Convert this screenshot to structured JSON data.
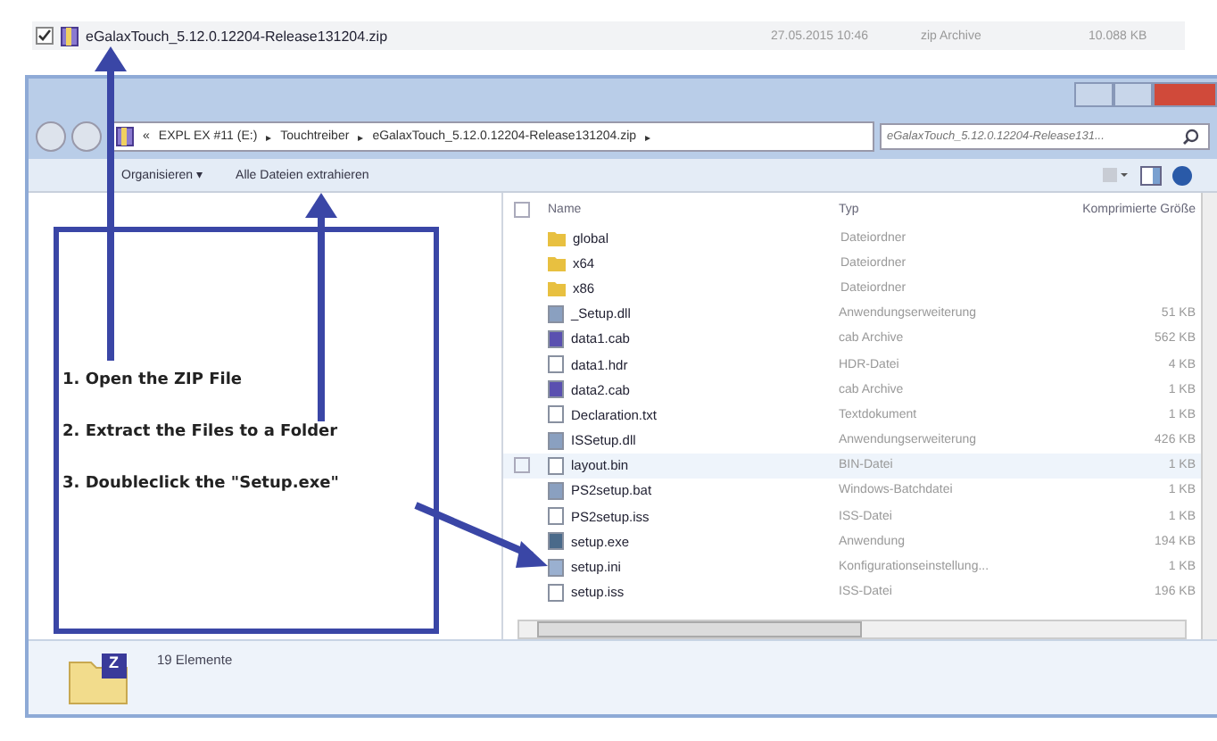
{
  "file_row": {
    "checked": true,
    "name": "eGalaxTouch_5.12.0.12204-Release131204.zip",
    "date": "27.05.2015 10:46",
    "type": "zip Archive",
    "size": "10.088 KB"
  },
  "address_bar": {
    "overflow": "«",
    "crumbs": [
      "EXPL EX #11 (E:)",
      "Touchtreiber",
      "eGalaxTouch_5.12.0.12204-Release131204.zip"
    ],
    "separator": "▸"
  },
  "search": {
    "placeholder": "eGalaxTouch_5.12.0.12204-Release131..."
  },
  "toolbar": {
    "organize": "Organisieren ▾",
    "extract": "Alle Dateien extrahieren"
  },
  "table": {
    "select_all_checked": false,
    "columns": [
      "Name",
      "Typ",
      "Komprimierte Größe"
    ],
    "rows": [
      {
        "kind": "folder",
        "name": "global",
        "type": "Dateiordner",
        "size": "",
        "highlighted": false
      },
      {
        "kind": "folder",
        "name": "x64",
        "type": "Dateiordner",
        "size": "",
        "highlighted": false
      },
      {
        "kind": "folder",
        "name": "x86",
        "type": "Dateiordner",
        "size": "",
        "highlighted": false
      },
      {
        "kind": "dll",
        "name": "_Setup.dll",
        "type": "Anwendungserweiterung",
        "size": "51 KB",
        "highlighted": false
      },
      {
        "kind": "cab",
        "name": "data1.cab",
        "type": "cab Archive",
        "size": "562 KB",
        "highlighted": false
      },
      {
        "kind": "file",
        "name": "data1.hdr",
        "type": "HDR-Datei",
        "size": "4 KB",
        "highlighted": false
      },
      {
        "kind": "cab",
        "name": "data2.cab",
        "type": "cab Archive",
        "size": "1 KB",
        "highlighted": false
      },
      {
        "kind": "file",
        "name": "Declaration.txt",
        "type": "Textdokument",
        "size": "1 KB",
        "highlighted": false
      },
      {
        "kind": "dll",
        "name": "ISSetup.dll",
        "type": "Anwendungserweiterung",
        "size": "426 KB",
        "highlighted": false
      },
      {
        "kind": "file",
        "name": "layout.bin",
        "type": "BIN-Datei",
        "size": "1 KB",
        "highlighted": true
      },
      {
        "kind": "dll",
        "name": "PS2setup.bat",
        "type": "Windows-Batchdatei",
        "size": "1 KB",
        "highlighted": false
      },
      {
        "kind": "file",
        "name": "PS2setup.iss",
        "type": "ISS-Datei",
        "size": "1 KB",
        "highlighted": false
      },
      {
        "kind": "exe",
        "name": "setup.exe",
        "type": "Anwendung",
        "size": "194 KB",
        "highlighted": false
      },
      {
        "kind": "ini",
        "name": "setup.ini",
        "type": "Konfigurationseinstellung...",
        "size": "1 KB",
        "highlighted": false
      },
      {
        "kind": "file",
        "name": "setup.iss",
        "type": "ISS-Datei",
        "size": "196 KB",
        "highlighted": false
      }
    ]
  },
  "status_bar": {
    "count": "19 Elemente",
    "badge": "Z"
  },
  "instructions": [
    "1. Open the ZIP File",
    "2. Extract the Files to a Folder",
    "3. Doubleclick the \"Setup.exe\""
  ]
}
